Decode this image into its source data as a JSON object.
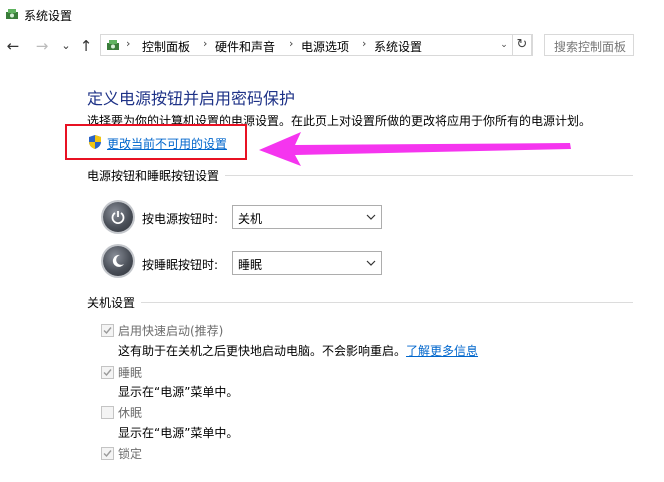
{
  "window": {
    "title": "系统设置",
    "icon": "power-options-icon"
  },
  "nav": {
    "back": "←",
    "forward": "→",
    "recent": "⌄",
    "up": "↑",
    "breadcrumbs": [
      "控制面板",
      "硬件和声音",
      "电源选项",
      "系统设置"
    ],
    "separator": "›",
    "address_dropdown": "⌄",
    "refresh": "↻",
    "search_placeholder": "搜索控制面板"
  },
  "main": {
    "heading": "定义电源按钮并启用密码保护",
    "description": "选择要为你的计算机设置的电源设置。在此页上对设置所做的更改将应用于你所有的电源计划。",
    "change_link": "更改当前不可用的设置"
  },
  "buttons_section": {
    "title": "电源按钮和睡眠按钮设置",
    "power_label": "按电源按钮时:",
    "power_value": "关机",
    "sleep_label": "按睡眠按钮时:",
    "sleep_value": "睡眠"
  },
  "shutdown_section": {
    "title": "关机设置",
    "items": [
      {
        "label": "启用快速启动(推荐)",
        "checked": true,
        "desc": "这有助于在关机之后更快地启动电脑。不会影响重启。",
        "link": "了解更多信息"
      },
      {
        "label": "睡眠",
        "checked": true,
        "desc": "显示在“电源”菜单中。"
      },
      {
        "label": "休眠",
        "checked": false,
        "desc": "显示在“电源”菜单中。"
      },
      {
        "label": "锁定",
        "checked": true
      }
    ]
  },
  "annotation": {
    "arrow_color": "#f535ef",
    "box_color": "#e81123"
  },
  "colors": {
    "heading": "#1e3287",
    "link": "#0066cc"
  }
}
